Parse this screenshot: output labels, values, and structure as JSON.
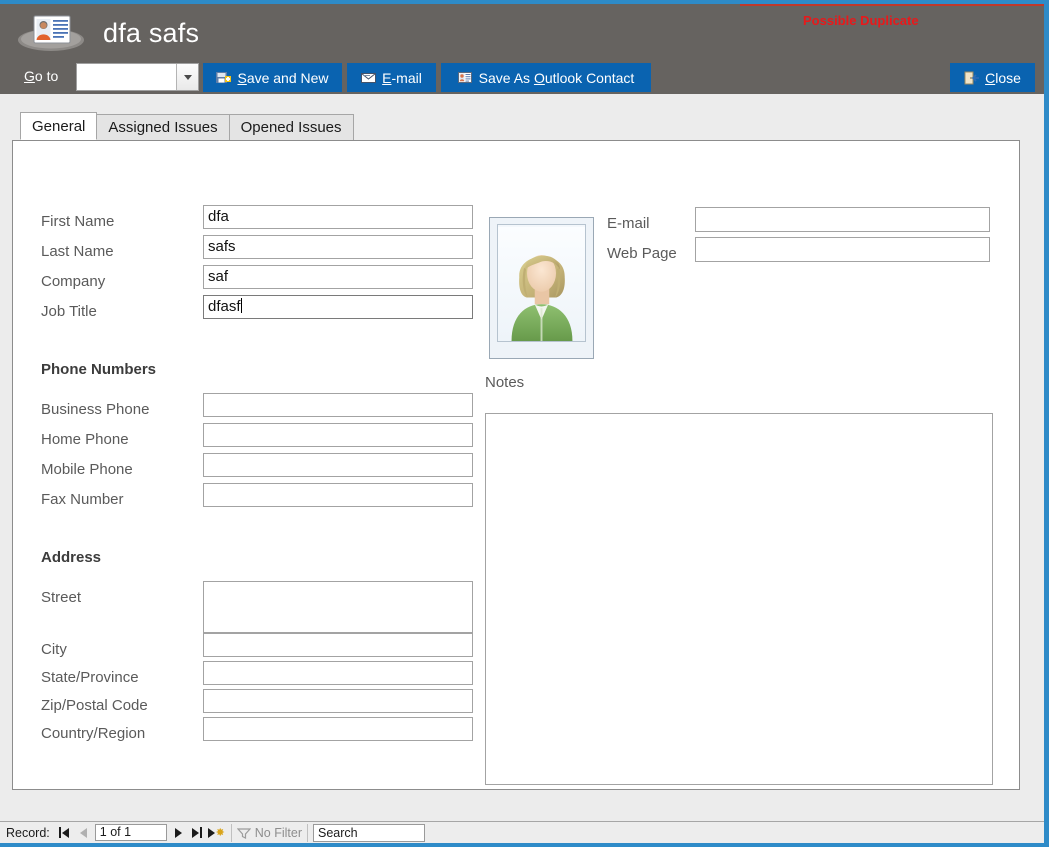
{
  "window": {
    "title": "dfa safs",
    "app_icon": "contact-card-icon",
    "duplicate_warning": "Possible Duplicate",
    "accent_color": "#2e8bc8",
    "header_color": "#666360",
    "button_color": "#0a63b0",
    "warning_color": "#e8191b"
  },
  "toolbar": {
    "goto_label_pre": "G",
    "goto_label_post": "o to",
    "goto_value": "",
    "save_new": {
      "pre": "",
      "u": "S",
      "post": "ave and New",
      "icon": "save-new-icon"
    },
    "email": {
      "pre": "",
      "u": "E",
      "post": "-mail",
      "icon": "envelope-icon"
    },
    "outlook": {
      "pre": "Save As ",
      "u": "O",
      "post": "utlook Contact",
      "icon": "outlook-contact-icon"
    },
    "close": {
      "pre": "",
      "u": "C",
      "post": "lose",
      "icon": "close-door-icon"
    }
  },
  "tabs": [
    {
      "label": "General",
      "active": true
    },
    {
      "label": "Assigned Issues",
      "active": false
    },
    {
      "label": "Opened Issues",
      "active": false
    }
  ],
  "form": {
    "identity": [
      {
        "label": "First Name",
        "value": "dfa",
        "focused": false
      },
      {
        "label": "Last Name",
        "value": "safs",
        "focused": false
      },
      {
        "label": "Company",
        "value": "saf",
        "focused": false
      },
      {
        "label": "Job Title",
        "value": "dfasf",
        "focused": true
      }
    ],
    "phone_section_title": "Phone Numbers",
    "phones": [
      {
        "label": "Business Phone",
        "value": ""
      },
      {
        "label": "Home Phone",
        "value": ""
      },
      {
        "label": "Mobile Phone",
        "value": ""
      },
      {
        "label": "Fax Number",
        "value": ""
      }
    ],
    "address_section_title": "Address",
    "address": [
      {
        "label": "Street",
        "value": ""
      },
      {
        "label": "City",
        "value": ""
      },
      {
        "label": "State/Province",
        "value": ""
      },
      {
        "label": "Zip/Postal Code",
        "value": ""
      },
      {
        "label": "Country/Region",
        "value": ""
      }
    ],
    "contact": [
      {
        "label": "E-mail",
        "value": ""
      },
      {
        "label": "Web Page",
        "value": ""
      }
    ],
    "photo": {
      "alt": "contact-photo-placeholder"
    },
    "notes_label": "Notes",
    "notes_value": ""
  },
  "statusbar": {
    "record_label": "Record:",
    "record_position": "1 of 1",
    "filter_label": "No Filter",
    "search_value": "Search",
    "first_icon": "first-record-icon",
    "prev_icon": "previous-record-icon",
    "next_icon": "next-record-icon",
    "last_icon": "last-record-icon",
    "new_icon": "new-record-icon",
    "filter_icon": "funnel-icon"
  }
}
